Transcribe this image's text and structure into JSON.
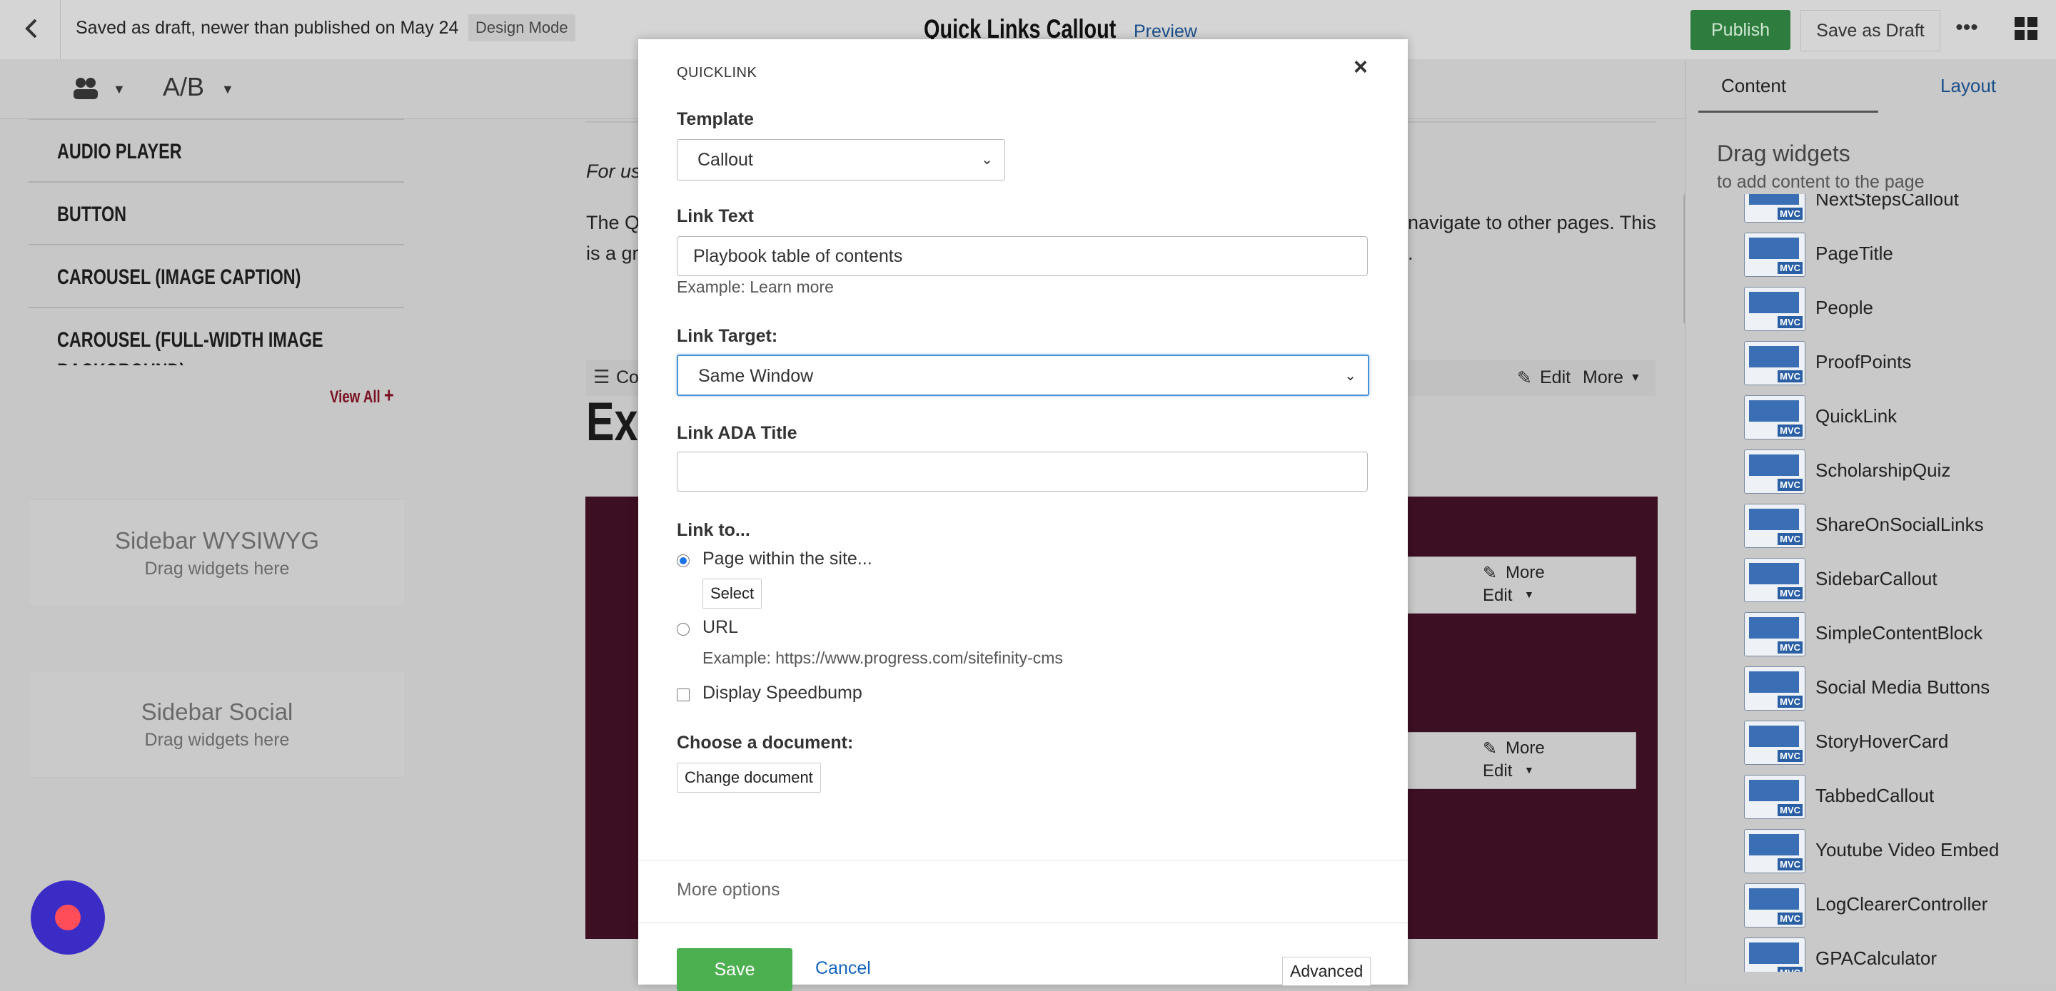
{
  "topbar": {
    "status_text": "Saved as draft, newer than published on May 24",
    "mode_badge": "Design Mode",
    "page_title": "Quick Links Callout",
    "preview_link": "Preview",
    "publish_button": "Publish",
    "save_draft_button": "Save as Draft",
    "more_icon": "ellipsis-icon",
    "apps_icon": "grid-icon"
  },
  "subbar": {
    "ab_label": "A/B"
  },
  "left_sidebar": {
    "items": [
      "AUDIO PLAYER",
      "BUTTON",
      "CAROUSEL (IMAGE CAPTION)",
      "CAROUSEL (FULL-WIDTH IMAGE"
    ],
    "partial_item": "BACKGROUND)",
    "view_all": "View All",
    "zones": [
      {
        "title": "Sidebar WYSIWYG",
        "hint": "Drag widgets here"
      },
      {
        "title": "Sidebar Social",
        "hint": "Drag widgets here"
      }
    ]
  },
  "center": {
    "italic_text": "For us",
    "para_line1_start": "The Q",
    "para_line1_end": "navigate to other pages. This",
    "para_line2_start": "is a gr",
    "para_line2_end": ".",
    "toolbar_label": "Co",
    "edit_label": "Edit",
    "more_label": "More",
    "heading_fragment": "Ex",
    "box1_more": "More",
    "box1_edit": "Edit",
    "box2_more": "More",
    "box2_edit": "Edit"
  },
  "right_panel": {
    "tabs": [
      "Content",
      "Layout"
    ],
    "heading": "Drag widgets",
    "subheading": "to add content to the page",
    "widgets": [
      "NextStepsCallout",
      "PageTitle",
      "People",
      "ProofPoints",
      "QuickLink",
      "ScholarshipQuiz",
      "ShareOnSocialLinks",
      "SidebarCallout",
      "SimpleContentBlock",
      "Social Media Buttons",
      "StoryHoverCard",
      "TabbedCallout",
      "Youtube Video Embed",
      "LogClearerController",
      "GPACalculator"
    ],
    "mvc_badge": "MVC"
  },
  "dialog": {
    "title": "QUICKLINK",
    "close_icon": "close-icon",
    "template_label": "Template",
    "template_value": "Callout",
    "link_text_label": "Link Text",
    "link_text_value": "Playbook table of contents",
    "link_text_hint": "Example: Learn more",
    "link_target_label": "Link Target:",
    "link_target_value": "Same Window",
    "ada_title_label": "Link ADA Title",
    "ada_title_value": "",
    "link_to_label": "Link to...",
    "option_page": "Page within the site...",
    "select_button": "Select",
    "option_url": "URL",
    "url_hint": "Example: https://www.progress.com/sitefinity-cms",
    "speedbump_label": "Display Speedbump",
    "document_label": "Choose a document:",
    "change_document_button": "Change document",
    "more_options": "More options",
    "save_button": "Save",
    "cancel_link": "Cancel",
    "advanced_button": "Advanced"
  },
  "record_button_icon": "record-icon",
  "colors": {
    "publish_green": "#2e7d3e",
    "save_green": "#4caf50",
    "link_blue": "#1565c0",
    "maroon": "#3d0f22",
    "record_purple": "#3b2cc6",
    "record_red": "#ff4d5a"
  }
}
